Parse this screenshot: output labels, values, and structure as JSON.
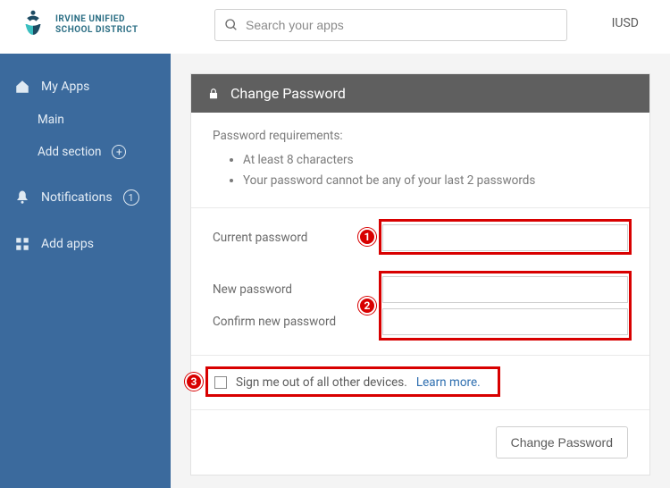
{
  "header": {
    "org_name_line1": "IRVINE UNIFIED",
    "org_name_line2": "SCHOOL DISTRICT",
    "search_placeholder": "Search your apps",
    "org_short": "IUSD"
  },
  "sidebar": {
    "my_apps": "My Apps",
    "main": "Main",
    "add_section": "Add section",
    "notifications": "Notifications",
    "notifications_count": "1",
    "add_apps": "Add apps"
  },
  "panel": {
    "title": "Change Password",
    "requirements_title": "Password requirements:",
    "requirements": [
      "At least 8 characters",
      "Your password cannot be any of your last 2 passwords"
    ],
    "form": {
      "current_label": "Current password",
      "new_label": "New password",
      "confirm_label": "Confirm new password",
      "current_value": "",
      "new_value": "",
      "confirm_value": ""
    },
    "signout": {
      "label": "Sign me out of all other devices.",
      "learn_more": "Learn more."
    },
    "submit_label": "Change Password"
  },
  "annotations": {
    "n1": "1",
    "n2": "2",
    "n3": "3"
  }
}
